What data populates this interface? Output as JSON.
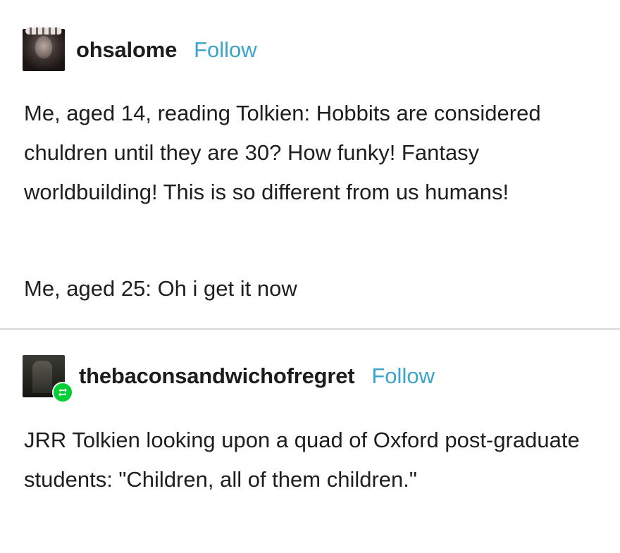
{
  "posts": [
    {
      "username": "ohsalome",
      "follow_label": "Follow",
      "paragraphs": [
        "Me, aged 14, reading Tolkien: Hobbits are considered chuldren until they are 30? How funky! Fantasy worldbuilding! This is so different from us humans!",
        "Me, aged 25: Oh i get it now"
      ]
    },
    {
      "username": "thebaconsandwichofregret",
      "follow_label": "Follow",
      "reblog_icon": "reblog-icon",
      "paragraphs": [
        "JRR Tolkien looking upon a quad of Oxford post-graduate students: \"Children, all of them children.\""
      ]
    }
  ],
  "colors": {
    "follow": "#3aa4cc",
    "reblog_badge": "#00cf35",
    "divider": "#d9d9d9",
    "text": "#1e1e1e"
  }
}
